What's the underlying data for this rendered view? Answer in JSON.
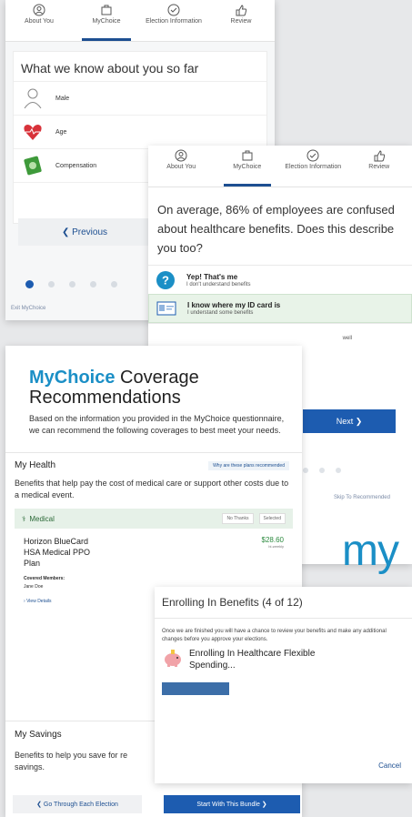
{
  "tabs": [
    {
      "label": "About You",
      "icon": "person-icon"
    },
    {
      "label": "MyChoice",
      "icon": "briefcase-icon",
      "active": true
    },
    {
      "label": "Election Information",
      "icon": "check-circle-icon"
    },
    {
      "label": "Review",
      "icon": "thumbs-up-icon"
    }
  ],
  "card1": {
    "heading": "What we know about you so far",
    "rows": [
      {
        "label": "Male",
        "icon": "person-outline-icon"
      },
      {
        "label": "Age",
        "icon": "heart-pulse-icon"
      },
      {
        "label": "Compensation",
        "icon": "money-icon"
      }
    ],
    "previous_label": "❮ Previous",
    "exit_label": "Exit MyChoice"
  },
  "card2": {
    "question": "On average, 86% of employees are confused about healthcare benefits. Does this describe you too?",
    "options": [
      {
        "title": "Yep! That's me",
        "subtitle": "I don't understand benefits",
        "icon": "question-icon",
        "selected": false
      },
      {
        "title": "I know where my ID card is",
        "subtitle": "I understand some benefits",
        "icon": "id-card-icon",
        "selected": true
      }
    ],
    "partial_text": "well",
    "next_label": "Next ❯",
    "skip_label": "Skip To Recommended"
  },
  "brand_fragment": "my",
  "card3": {
    "brand_prefix": "MyChoice",
    "title_rest": " Coverage",
    "title_line2": "Recommendations",
    "intro": "Based on the information you provided in the MyChoice questionnaire, we can recommend the following coverages to best meet your needs.",
    "health_title": "My Health",
    "why_link": "Why are these plans recommended",
    "health_desc": "Benefits that help pay the cost of medical care or support other costs due to a medical event.",
    "medical_label": "Medical",
    "no_thanks": "No Thanks",
    "selected": "Selected",
    "plan_line1": "Horizon BlueCard",
    "plan_line2": "HSA Medical PPO",
    "plan_line3": "Plan",
    "price": "$28.60",
    "price_period": "bi-weekly",
    "covered_label": "Covered Members:",
    "covered_value": "Jane Doe",
    "view_details": "View Details",
    "savings_title": "My Savings",
    "savings_desc_1": "Benefits to help you save for re",
    "savings_desc_2": "savings.",
    "go_through_label": "❮ Go Through Each Election",
    "start_bundle_label": "Start With This Bundle ❯"
  },
  "card4": {
    "title": "Enrolling In Benefits (4 of 12)",
    "note": "Once we are finished you will have a chance to review your benefits and make any additional changes before you approve your elections.",
    "enrolling_line1": "Enrolling In Healthcare Flexible",
    "enrolling_line2": "Spending...",
    "progress": 0.3,
    "cancel_label": "Cancel"
  },
  "colors": {
    "primary": "#1d5cb0",
    "brand": "#1b8fc6",
    "selected_bg": "#e8f3e8"
  }
}
